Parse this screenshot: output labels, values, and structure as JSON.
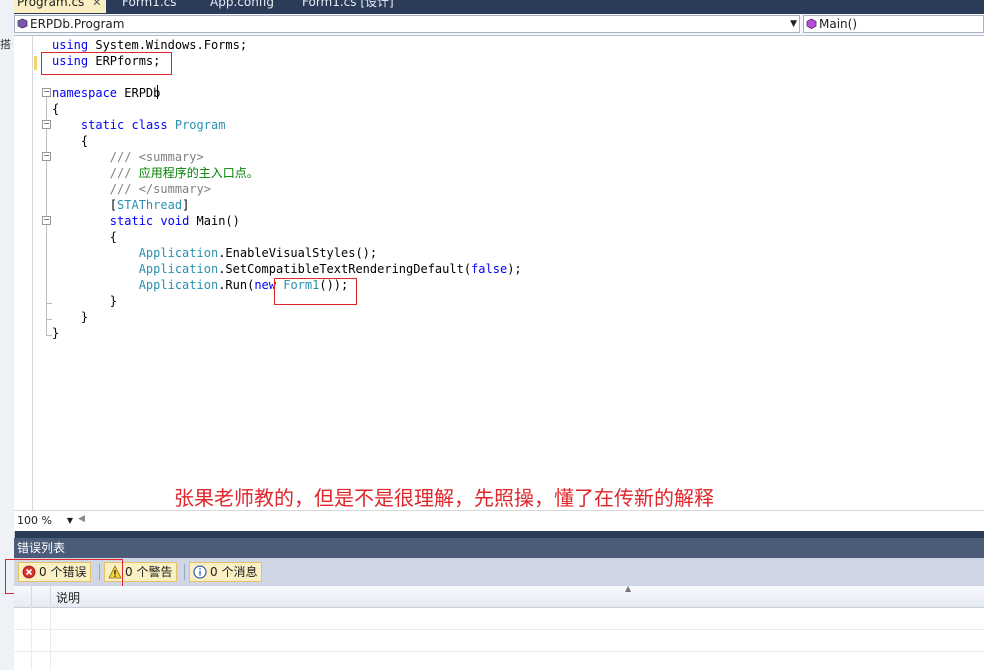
{
  "tabs": [
    {
      "label": "Program.cs",
      "active": true
    },
    {
      "label": "Form1.cs",
      "active": false
    },
    {
      "label": "App.config",
      "active": false
    },
    {
      "label": "Form1.cs [设计]",
      "active": false
    }
  ],
  "navbar": {
    "class_combo": "ERPDb.Program",
    "member_combo": "Main()"
  },
  "code": {
    "lines": [
      [
        {
          "t": "using",
          "c": "kw"
        },
        {
          "t": " System.Windows.Forms;"
        }
      ],
      [
        {
          "t": "using",
          "c": "kw"
        },
        {
          "t": " ERPforms;"
        }
      ],
      [],
      [
        {
          "t": "namespace",
          "c": "kw"
        },
        {
          "t": " ERPDb"
        }
      ],
      [
        {
          "t": "{"
        }
      ],
      [
        {
          "t": "    "
        },
        {
          "t": "static",
          "c": "kw"
        },
        {
          "t": " "
        },
        {
          "t": "class",
          "c": "kw"
        },
        {
          "t": " "
        },
        {
          "t": "Program",
          "c": "ty"
        }
      ],
      [
        {
          "t": "    {"
        }
      ],
      [
        {
          "t": "        "
        },
        {
          "t": "/// ",
          "c": "cg"
        },
        {
          "t": "<summary>",
          "c": "cg"
        }
      ],
      [
        {
          "t": "        "
        },
        {
          "t": "/// ",
          "c": "cg"
        },
        {
          "t": "应用程序的主入口点。",
          "c": "cm"
        }
      ],
      [
        {
          "t": "        "
        },
        {
          "t": "/// ",
          "c": "cg"
        },
        {
          "t": "</summary>",
          "c": "cg"
        }
      ],
      [
        {
          "t": "        ["
        },
        {
          "t": "STAThread",
          "c": "ty"
        },
        {
          "t": "]"
        }
      ],
      [
        {
          "t": "        "
        },
        {
          "t": "static",
          "c": "kw"
        },
        {
          "t": " "
        },
        {
          "t": "void",
          "c": "kw"
        },
        {
          "t": " Main()"
        }
      ],
      [
        {
          "t": "        {"
        }
      ],
      [
        {
          "t": "            "
        },
        {
          "t": "Application",
          "c": "ty"
        },
        {
          "t": ".EnableVisualStyles();"
        }
      ],
      [
        {
          "t": "            "
        },
        {
          "t": "Application",
          "c": "ty"
        },
        {
          "t": ".SetCompatibleTextRenderingDefault("
        },
        {
          "t": "false",
          "c": "kw"
        },
        {
          "t": ");"
        }
      ],
      [
        {
          "t": "            "
        },
        {
          "t": "Application",
          "c": "ty"
        },
        {
          "t": ".Run("
        },
        {
          "t": "new",
          "c": "kw"
        },
        {
          "t": " "
        },
        {
          "t": "Form1",
          "c": "ty"
        },
        {
          "t": "());"
        }
      ],
      [
        {
          "t": "        }"
        }
      ],
      [
        {
          "t": "    }"
        }
      ],
      [
        {
          "t": "}"
        }
      ]
    ]
  },
  "annotation": "张果老师教的，但是不是很理解，先照操，懂了在传新的解释",
  "zoom": "100 %",
  "error_panel": {
    "title": "错误列表",
    "errors_label": "0 个错误",
    "warnings_label": "0 个警告",
    "messages_label": "0 个消息",
    "description_header": "说明"
  },
  "colors": {
    "accent_red": "#e0262b",
    "keyword": "#0000ff",
    "type": "#2b91af",
    "comment": "#008000",
    "panel_bg": "#2b3c59"
  }
}
